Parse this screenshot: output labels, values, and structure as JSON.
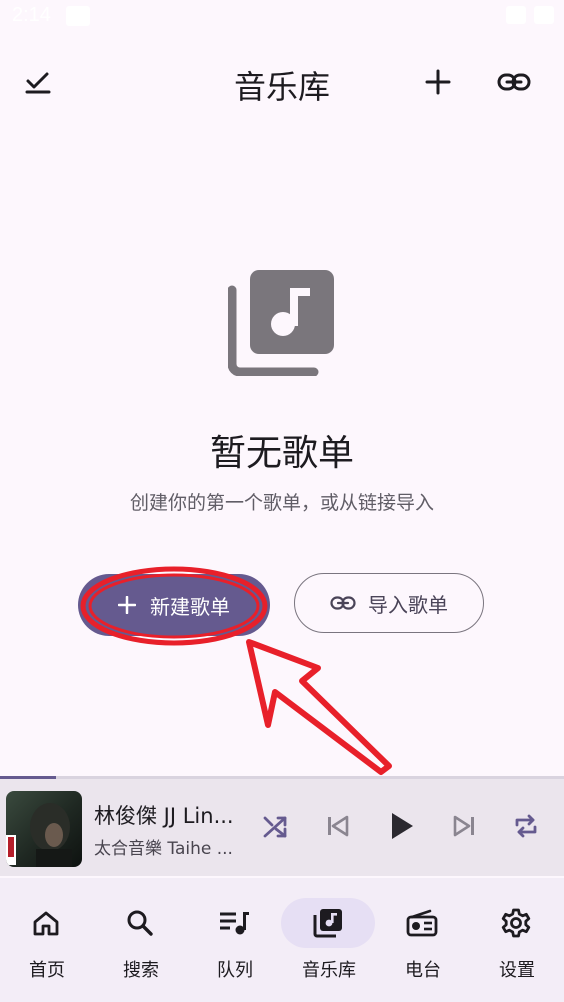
{
  "status_bar": {
    "time": "2:14"
  },
  "header": {
    "title": "音乐库"
  },
  "empty_state": {
    "title": "暂无歌单",
    "subtitle": "创建你的第一个歌单，或从链接导入",
    "new_button": "新建歌单",
    "import_button": "导入歌单"
  },
  "player": {
    "title": "林俊傑 JJ Lin...",
    "artist": "太合音樂 Taihe ...",
    "progress": 0.1
  },
  "nav": {
    "items": [
      {
        "label": "首页",
        "icon": "home-icon"
      },
      {
        "label": "搜索",
        "icon": "search-icon"
      },
      {
        "label": "队列",
        "icon": "queue-icon"
      },
      {
        "label": "音乐库",
        "icon": "library-music-icon",
        "active": true
      },
      {
        "label": "电台",
        "icon": "radio-icon"
      },
      {
        "label": "设置",
        "icon": "settings-icon"
      }
    ]
  },
  "colors": {
    "accent": "#655a8f",
    "background": "#fdf7fd",
    "annotation": "#e8202a"
  }
}
